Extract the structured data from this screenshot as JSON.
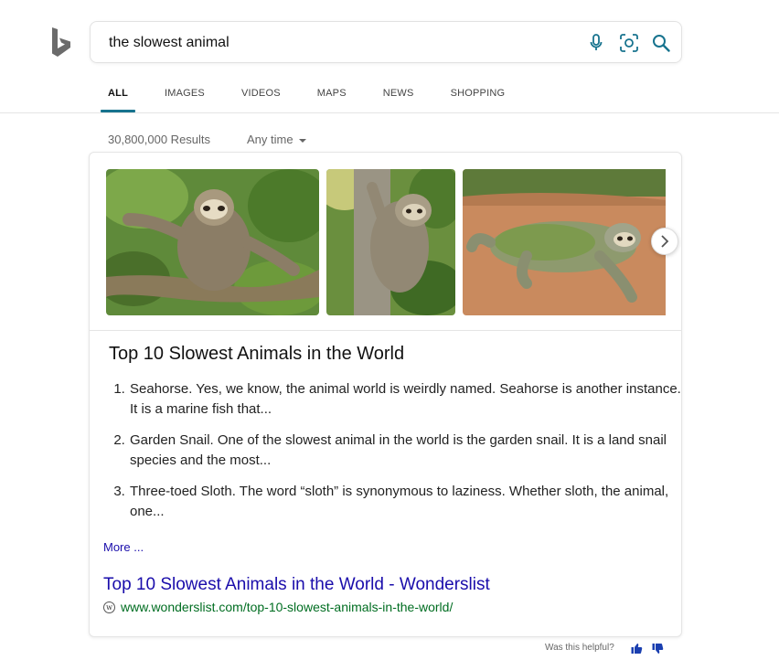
{
  "search": {
    "query": "the slowest animal"
  },
  "tabs": [
    {
      "label": "ALL",
      "active": true
    },
    {
      "label": "IMAGES"
    },
    {
      "label": "VIDEOS"
    },
    {
      "label": "MAPS"
    },
    {
      "label": "NEWS"
    },
    {
      "label": "SHOPPING"
    }
  ],
  "results": {
    "count": "30,800,000 Results",
    "time_filter": "Any time"
  },
  "answer": {
    "title": "Top 10 Slowest Animals in the World",
    "items": [
      "Seahorse. Yes, we know, the animal world is weirdly named. Seahorse is another instance. It is a marine fish that...",
      "Garden Snail. One of the slowest animal in the world is the garden snail. It is a land snail species and the most...",
      "Three-toed Sloth. The word “sloth” is synonymous to laziness. Whether sloth, the animal, one..."
    ],
    "more_label": "More ...",
    "source_title": "Top 10 Slowest Animals in the World - Wonderslist",
    "source_url": "www.wonderslist.com/top-10-slowest-animals-in-the-world/"
  },
  "feedback": {
    "label": "Was this helpful?"
  },
  "icons": {
    "logo": "bing-logo-icon",
    "mic": "microphone-icon",
    "camera": "visual-search-icon",
    "search": "search-icon",
    "next": "chevron-right-icon",
    "thumbs_up": "thumbs-up-icon",
    "thumbs_down": "thumbs-down-icon",
    "favicon": "wonderslist-favicon-icon"
  },
  "colors": {
    "accent": "#17738e",
    "link": "#1a0dab",
    "url_green": "#006d21",
    "logo_gray": "#6b6b6b"
  }
}
